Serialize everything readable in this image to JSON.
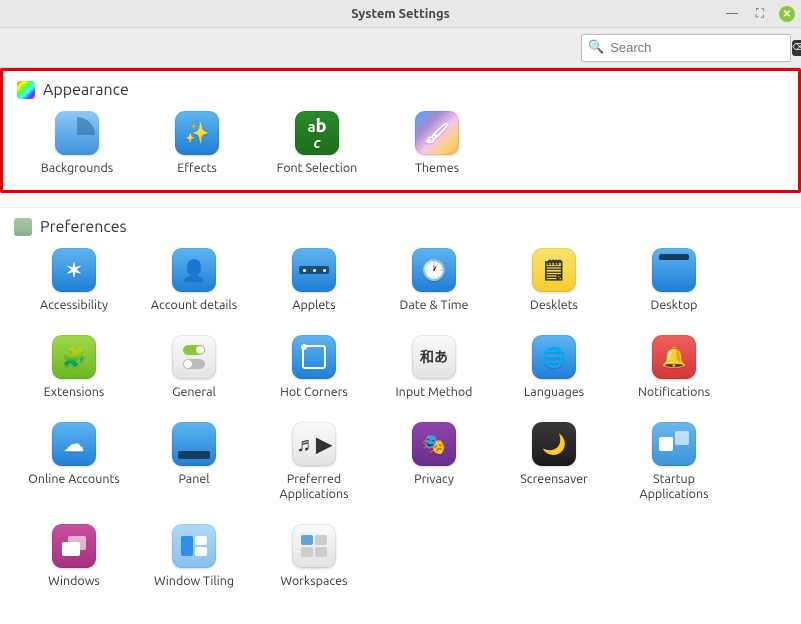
{
  "window": {
    "title": "System Settings"
  },
  "search": {
    "placeholder": "Search"
  },
  "sections": {
    "appearance": {
      "label": "Appearance",
      "items": [
        {
          "label": "Backgrounds",
          "name": "backgrounds"
        },
        {
          "label": "Effects",
          "name": "effects"
        },
        {
          "label": "Font Selection",
          "name": "font-selection"
        },
        {
          "label": "Themes",
          "name": "themes"
        }
      ]
    },
    "preferences": {
      "label": "Preferences",
      "items": [
        {
          "label": "Accessibility",
          "name": "accessibility"
        },
        {
          "label": "Account details",
          "name": "account-details"
        },
        {
          "label": "Applets",
          "name": "applets"
        },
        {
          "label": "Date & Time",
          "name": "date-time"
        },
        {
          "label": "Desklets",
          "name": "desklets"
        },
        {
          "label": "Desktop",
          "name": "desktop"
        },
        {
          "label": "Extensions",
          "name": "extensions"
        },
        {
          "label": "General",
          "name": "general"
        },
        {
          "label": "Hot Corners",
          "name": "hot-corners"
        },
        {
          "label": "Input Method",
          "name": "input-method"
        },
        {
          "label": "Languages",
          "name": "languages"
        },
        {
          "label": "Notifications",
          "name": "notifications"
        },
        {
          "label": "Online Accounts",
          "name": "online-accounts"
        },
        {
          "label": "Panel",
          "name": "panel"
        },
        {
          "label": "Preferred Applications",
          "name": "preferred-applications"
        },
        {
          "label": "Privacy",
          "name": "privacy"
        },
        {
          "label": "Screensaver",
          "name": "screensaver"
        },
        {
          "label": "Startup Applications",
          "name": "startup-applications"
        },
        {
          "label": "Windows",
          "name": "windows"
        },
        {
          "label": "Window Tiling",
          "name": "window-tiling"
        },
        {
          "label": "Workspaces",
          "name": "workspaces"
        }
      ]
    }
  }
}
